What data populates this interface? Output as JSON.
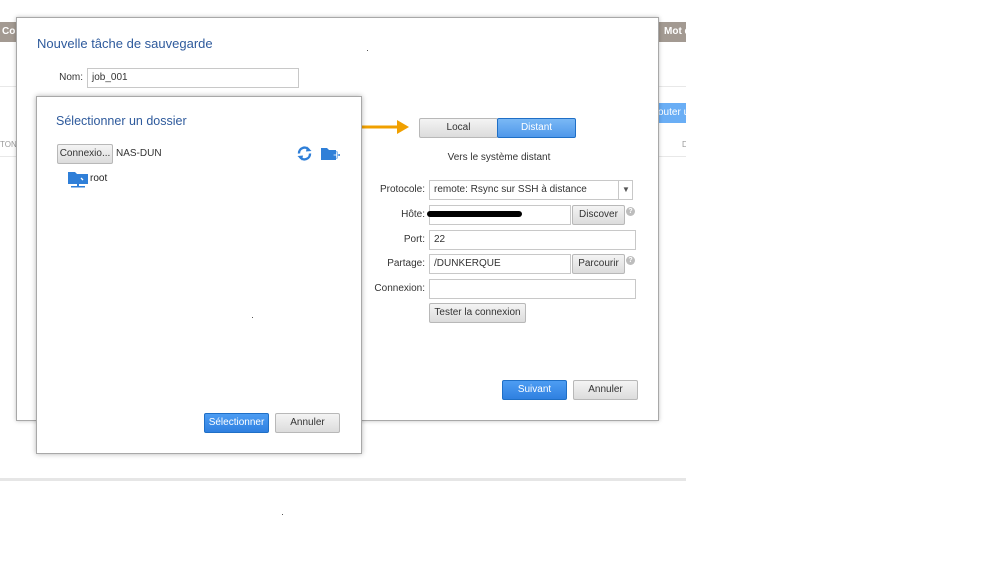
{
  "background": {
    "tab_left": "Con",
    "tab_right": "Mot d",
    "col_left": "TON D",
    "col_right": "D",
    "add_button": "outer un"
  },
  "main_dialog": {
    "title": "Nouvelle tâche de sauvegarde",
    "name_label": "Nom:",
    "name_value": "job_001",
    "toggle_local": "Local",
    "toggle_remote": "Distant",
    "subtitle": "Vers le système distant",
    "protocol_label": "Protocole:",
    "protocol_value": "remote: Rsync sur SSH à distance",
    "host_label": "Hôte:",
    "discover_button": "Discover",
    "port_label": "Port:",
    "port_value": "22",
    "share_label": "Partage:",
    "share_value": "/DUNKERQUE",
    "browse_button": "Parcourir",
    "connection_label": "Connexion:",
    "connection_value": "",
    "test_button": "Tester la connexion",
    "next_button": "Suivant",
    "cancel_button": "Annuler",
    "help_glyph": "?"
  },
  "folder_dialog": {
    "title": "Sélectionner un dossier",
    "connection_button": "Connexio...",
    "server_name": "NAS-DUN",
    "tree_root": "root",
    "select_button": "Sélectionner",
    "cancel_button": "Annuler"
  },
  "colors": {
    "accent_blue": "#2f80e0",
    "title_blue": "#2e5a9c",
    "arrow_orange": "#f0a000",
    "icon_blue": "#2f7fd8"
  }
}
